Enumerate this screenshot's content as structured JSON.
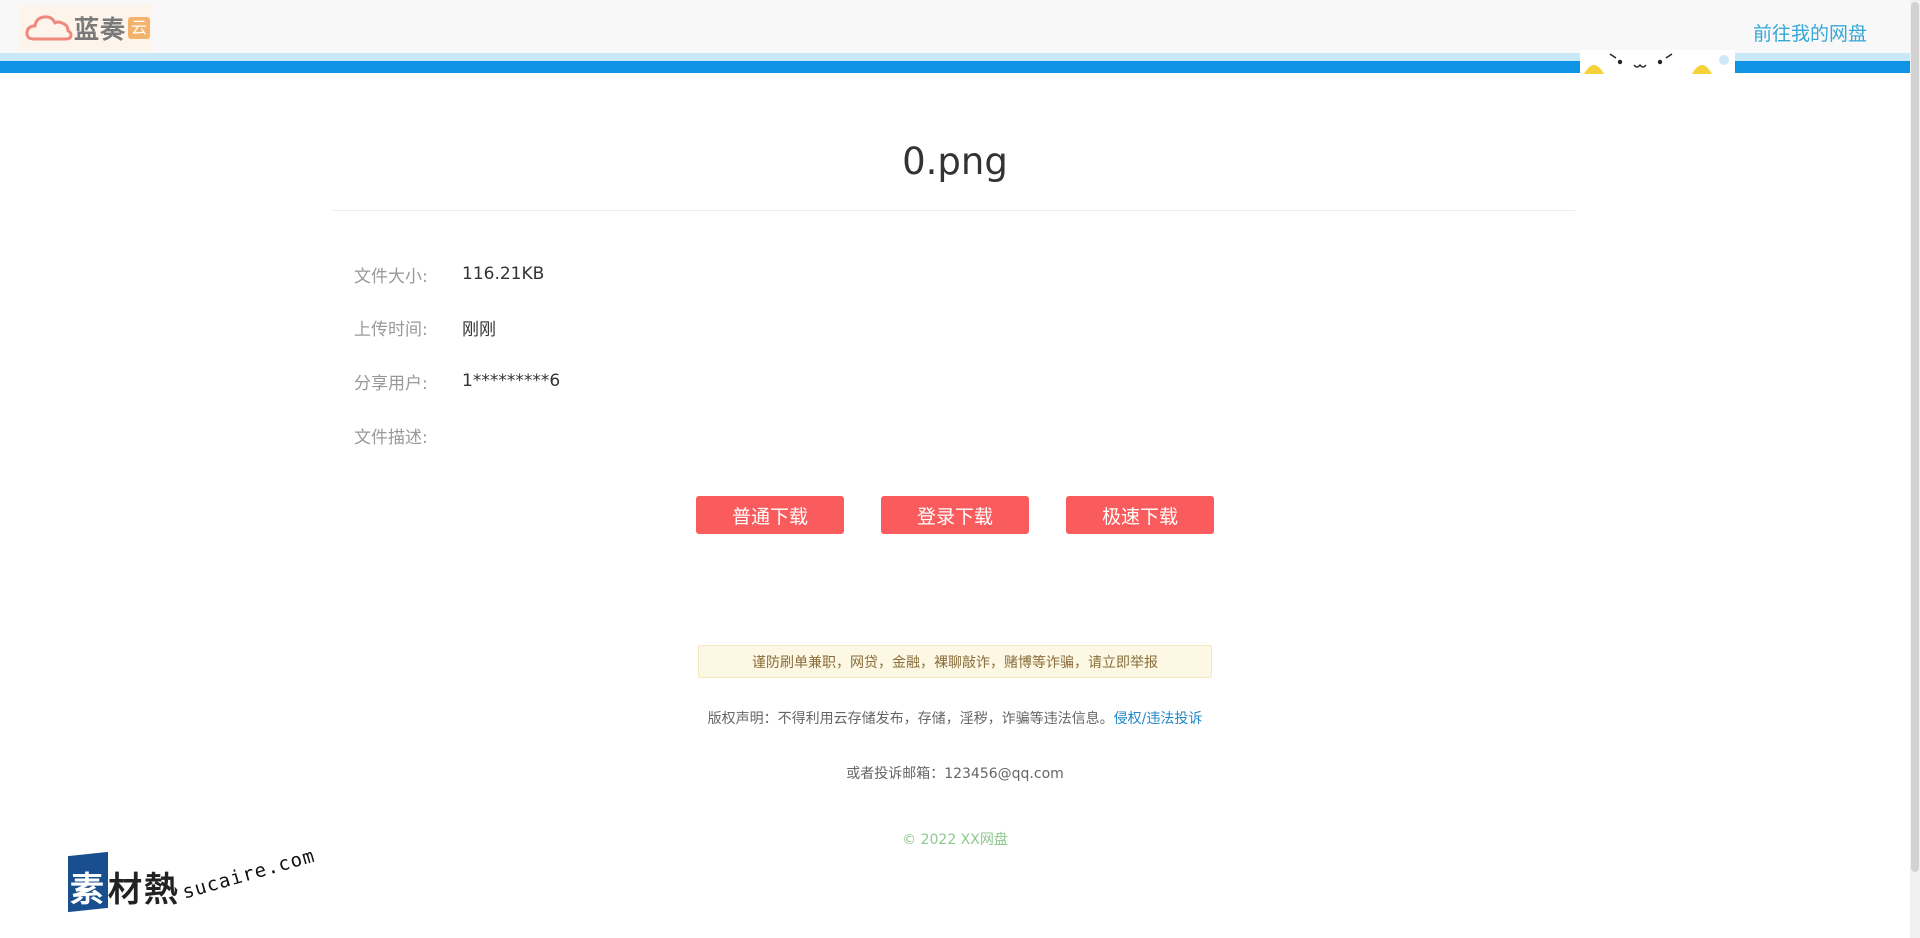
{
  "header": {
    "logo_text": "蓝奏",
    "logo_badge": "云",
    "nav_link": "前往我的网盘"
  },
  "file": {
    "title": "0.png",
    "rows": [
      {
        "label": "文件大小:",
        "value": "116.21KB"
      },
      {
        "label": "上传时间:",
        "value": "刚刚"
      },
      {
        "label": "分享用户:",
        "value": "1*********6"
      },
      {
        "label": "文件描述:",
        "value": ""
      }
    ]
  },
  "buttons": {
    "normal": "普通下载",
    "login": "登录下载",
    "fast": "极速下载"
  },
  "warning": "谨防刷单兼职，网贷，金融，裸聊敲诈，赌博等诈骗，请立即举报",
  "copyright": {
    "text": "版权声明：不得利用云存储发布，存储，淫秽，诈骗等违法信息。",
    "link": "侵权/违法投诉"
  },
  "email": "或者投诉邮箱：123456@qq.com",
  "footer": "© 2022 XX网盘",
  "watermark": {
    "chars": [
      "素",
      "材",
      "熱"
    ],
    "url": "sucaire.com"
  },
  "colors": {
    "accent_blue": "#0f93e5",
    "button_red": "#fa5c5e",
    "link_blue": "#35a8d6",
    "footer_green": "#8cc98c"
  }
}
